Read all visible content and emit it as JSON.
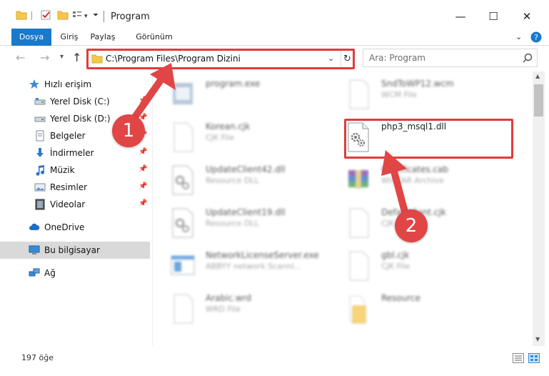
{
  "window": {
    "title": "Program",
    "minimize_glyph": "—",
    "maximize_glyph": "☐",
    "close_glyph": "✕"
  },
  "ribbon": {
    "tabs": [
      "Dosya",
      "Giriş",
      "Paylaş",
      "Görünüm"
    ],
    "accent_color": "#1979ca"
  },
  "address": {
    "path": "C:\\Program Files\\Program Dizini",
    "search_placeholder": "Ara: Program"
  },
  "sidebar": {
    "items": [
      {
        "label": "Hızlı erişim",
        "icon": "star-icon",
        "pinned": false
      },
      {
        "label": "Yerel Disk (C:)",
        "icon": "drive-icon",
        "pinned": true
      },
      {
        "label": "Yerel Disk (D:)",
        "icon": "drive-icon",
        "pinned": true
      },
      {
        "label": "Belgeler",
        "icon": "documents-icon",
        "pinned": true
      },
      {
        "label": "İndirmeler",
        "icon": "download-icon",
        "pinned": true
      },
      {
        "label": "Müzik",
        "icon": "music-icon",
        "pinned": true
      },
      {
        "label": "Resimler",
        "icon": "pictures-icon",
        "pinned": true
      },
      {
        "label": "Videolar",
        "icon": "video-icon",
        "pinned": true
      },
      {
        "label": "OneDrive",
        "icon": "cloud-icon",
        "pinned": false
      },
      {
        "label": "Bu bilgisayar",
        "icon": "computer-icon",
        "pinned": false,
        "selected": true
      },
      {
        "label": "Ağ",
        "icon": "network-icon",
        "pinned": false
      }
    ]
  },
  "files": [
    {
      "name": "program.exe",
      "type": "",
      "icon": "exe-icon",
      "blurred": true
    },
    {
      "name": "SndToWP12.wcm",
      "type": "WCM File",
      "icon": "file-icon",
      "blurred": true
    },
    {
      "name": "Korean.cjk",
      "type": "CJK File",
      "icon": "file-icon",
      "blurred": true
    },
    {
      "name": "php3_msql1.dll",
      "type": "",
      "icon": "dll-gear-icon",
      "blurred": false
    },
    {
      "name": "UpdateClient42.dll",
      "type": "Resource DLL",
      "icon": "dll-gear-icon",
      "blurred": true
    },
    {
      "name": "Certificates.cab",
      "type": "WinRAR Archive",
      "icon": "winrar-icon",
      "blurred": true
    },
    {
      "name": "UpdateClient19.dll",
      "type": "Resource DLL",
      "icon": "dll-gear-icon",
      "blurred": true
    },
    {
      "name": "DefaultFont.cjk",
      "type": "CJK File",
      "icon": "file-icon",
      "blurred": true
    },
    {
      "name": "NetworkLicenseServer.exe",
      "type": "ABBYY network Scanni...",
      "icon": "window-exe-icon",
      "blurred": true
    },
    {
      "name": "gbl.cjk",
      "type": "CJK File",
      "icon": "file-icon",
      "blurred": true
    },
    {
      "name": "Arabic.wrd",
      "type": "WRD File",
      "icon": "file-icon",
      "blurred": true
    },
    {
      "name": "Resource",
      "type": "",
      "icon": "folder-icon",
      "blurred": true
    }
  ],
  "status": {
    "count": "197 öğe"
  },
  "callouts": {
    "step1": "1",
    "step2": "2",
    "color": "#e23b3b"
  }
}
